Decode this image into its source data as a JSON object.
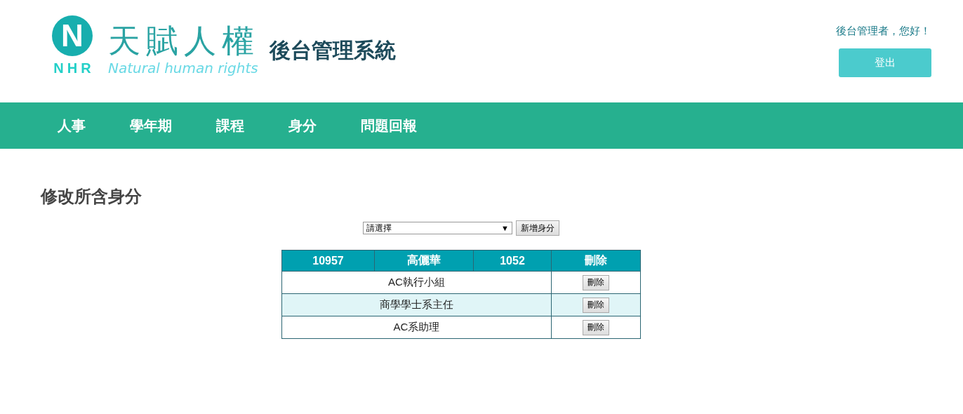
{
  "logo": {
    "mark": "N",
    "initials": "NHR",
    "name": "天賦人權",
    "tagline": "Natural human rights"
  },
  "site_title": "後台管理系統",
  "greeting": "後台管理者，您好！",
  "logout_button": "登出",
  "nav": [
    {
      "label": "人事"
    },
    {
      "label": "學年期"
    },
    {
      "label": "課程"
    },
    {
      "label": "身分"
    },
    {
      "label": "問題回報"
    }
  ],
  "page_title": "修改所含身分",
  "role_select": {
    "value": "請選擇",
    "arrow": "▼"
  },
  "add_button": "新增身分",
  "table": {
    "columns": [
      "10957",
      "高儷華",
      "1052",
      "刪除"
    ],
    "rows": [
      {
        "role": "AC執行小組",
        "action": "刪除"
      },
      {
        "role": "商學學士系主任",
        "action": "刪除"
      },
      {
        "role": "AC系助理",
        "action": "刪除"
      }
    ]
  }
}
